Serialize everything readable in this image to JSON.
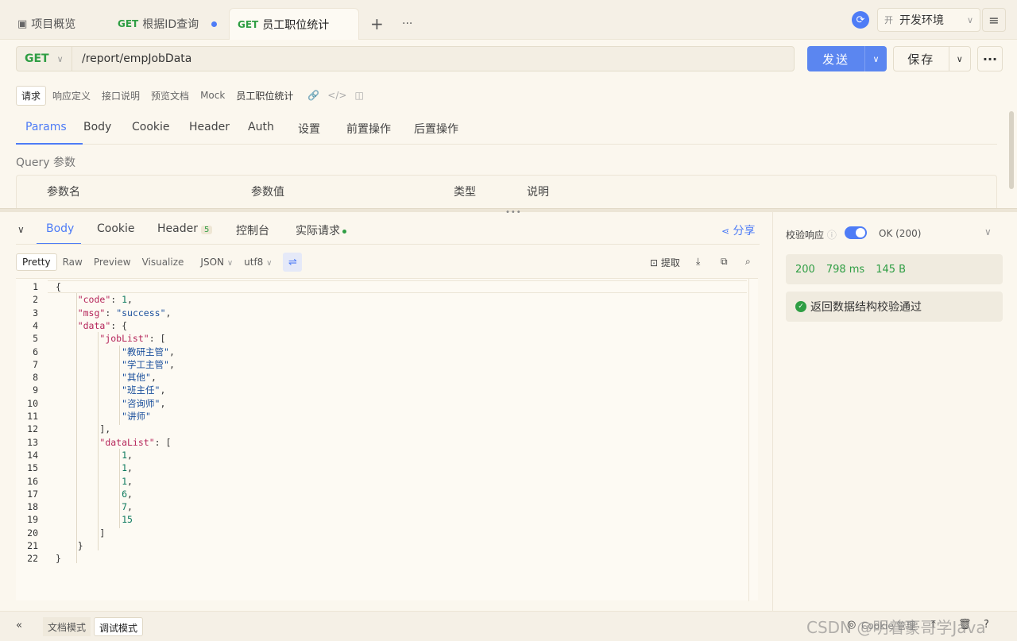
{
  "tabs": {
    "overview": "项目概览",
    "tab1_method": "GET",
    "tab1_label": "根据ID查询",
    "tab2_method": "GET",
    "tab2_label": "员工职位统计",
    "add": "+",
    "more": "···"
  },
  "env": {
    "badge": "开",
    "label": "开发环境"
  },
  "request": {
    "method": "GET",
    "url": "/report/empJobData",
    "send": "发送",
    "save": "保存",
    "more": "···"
  },
  "subtabs": [
    "请求",
    "响应定义",
    "接口说明",
    "预览文档",
    "Mock"
  ],
  "api_name": "员工职位统计",
  "param_tabs": [
    "Params",
    "Body",
    "Cookie",
    "Header",
    "Auth",
    "设置",
    "前置操作",
    "后置操作"
  ],
  "query": {
    "label": "Query 参数",
    "headers": [
      "参数名",
      "参数值",
      "类型",
      "说明"
    ]
  },
  "response_tabs": {
    "body": "Body",
    "cookie": "Cookie",
    "header": "Header",
    "header_count": "5",
    "console": "控制台",
    "actual": "实际请求",
    "share": "分享"
  },
  "format": {
    "modes": [
      "Pretty",
      "Raw",
      "Preview",
      "Visualize"
    ],
    "type": "JSON",
    "encoding": "utf8",
    "extract": "提取"
  },
  "code_lines": [
    [
      [
        "p",
        "{"
      ]
    ],
    [
      [
        "p",
        "    "
      ],
      [
        "k",
        "\"code\""
      ],
      [
        "p",
        ": "
      ],
      [
        "n",
        "1"
      ],
      [
        "p",
        ","
      ]
    ],
    [
      [
        "p",
        "    "
      ],
      [
        "k",
        "\"msg\""
      ],
      [
        "p",
        ": "
      ],
      [
        "s",
        "\"success\""
      ],
      [
        "p",
        ","
      ]
    ],
    [
      [
        "p",
        "    "
      ],
      [
        "k",
        "\"data\""
      ],
      [
        "p",
        ": {"
      ]
    ],
    [
      [
        "p",
        "        "
      ],
      [
        "k",
        "\"jobList\""
      ],
      [
        "p",
        ": ["
      ]
    ],
    [
      [
        "p",
        "            "
      ],
      [
        "s",
        "\"教研主管\""
      ],
      [
        "p",
        ","
      ]
    ],
    [
      [
        "p",
        "            "
      ],
      [
        "s",
        "\"学工主管\""
      ],
      [
        "p",
        ","
      ]
    ],
    [
      [
        "p",
        "            "
      ],
      [
        "s",
        "\"其他\""
      ],
      [
        "p",
        ","
      ]
    ],
    [
      [
        "p",
        "            "
      ],
      [
        "s",
        "\"班主任\""
      ],
      [
        "p",
        ","
      ]
    ],
    [
      [
        "p",
        "            "
      ],
      [
        "s",
        "\"咨询师\""
      ],
      [
        "p",
        ","
      ]
    ],
    [
      [
        "p",
        "            "
      ],
      [
        "s",
        "\"讲师\""
      ]
    ],
    [
      [
        "p",
        "        ],"
      ]
    ],
    [
      [
        "p",
        "        "
      ],
      [
        "k",
        "\"dataList\""
      ],
      [
        "p",
        ": ["
      ]
    ],
    [
      [
        "p",
        "            "
      ],
      [
        "n",
        "1"
      ],
      [
        "p",
        ","
      ]
    ],
    [
      [
        "p",
        "            "
      ],
      [
        "n",
        "1"
      ],
      [
        "p",
        ","
      ]
    ],
    [
      [
        "p",
        "            "
      ],
      [
        "n",
        "1"
      ],
      [
        "p",
        ","
      ]
    ],
    [
      [
        "p",
        "            "
      ],
      [
        "n",
        "6"
      ],
      [
        "p",
        ","
      ]
    ],
    [
      [
        "p",
        "            "
      ],
      [
        "n",
        "7"
      ],
      [
        "p",
        ","
      ]
    ],
    [
      [
        "p",
        "            "
      ],
      [
        "n",
        "15"
      ]
    ],
    [
      [
        "p",
        "        ]"
      ]
    ],
    [
      [
        "p",
        "    }"
      ]
    ],
    [
      [
        "p",
        "}"
      ]
    ]
  ],
  "validation": {
    "label": "校验响应",
    "status_text": "OK (200)",
    "code": "200",
    "time": "798 ms",
    "size": "145 B",
    "pass": "返回数据结构校验通过"
  },
  "bottom": {
    "doc_mode": "文档模式",
    "debug_mode": "调试模式",
    "cookie": "Cookie 管理",
    "watermark": "CSDN @明着豪哥学Java"
  },
  "colors": {
    "accent": "#4e7cf6",
    "get": "#2f9e44",
    "bg": "#fbf7ee"
  }
}
